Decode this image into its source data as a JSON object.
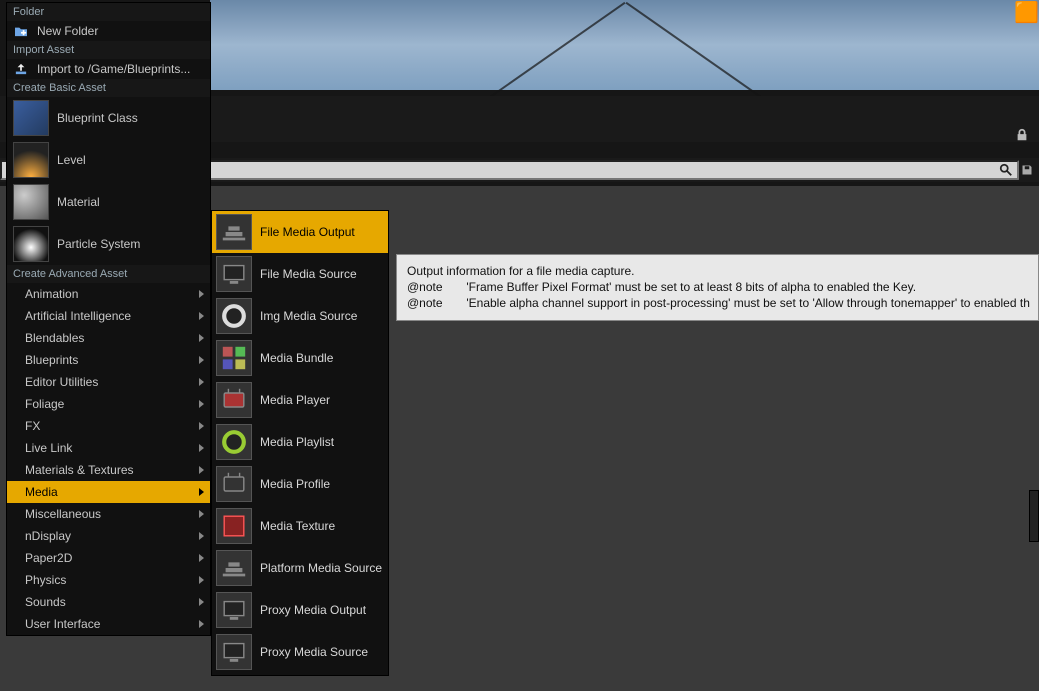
{
  "contextMenu": {
    "sections": {
      "folder": {
        "header": "Folder",
        "newFolder": "New Folder"
      },
      "importAsset": {
        "header": "Import Asset",
        "importTo": "Import to /Game/Blueprints..."
      },
      "createBasic": {
        "header": "Create Basic Asset",
        "items": {
          "blueprintClass": "Blueprint Class",
          "level": "Level",
          "material": "Material",
          "particleSystem": "Particle System"
        }
      },
      "createAdvanced": {
        "header": "Create Advanced Asset",
        "items": [
          "Animation",
          "Artificial Intelligence",
          "Blendables",
          "Blueprints",
          "Editor Utilities",
          "Foliage",
          "FX",
          "Live Link",
          "Materials & Textures",
          "Media",
          "Miscellaneous",
          "nDisplay",
          "Paper2D",
          "Physics",
          "Sounds",
          "User Interface"
        ],
        "selected": "Media"
      }
    }
  },
  "mediaSubmenu": {
    "items": [
      "File Media Output",
      "File Media Source",
      "Img Media Source",
      "Media Bundle",
      "Media Player",
      "Media Playlist",
      "Media Profile",
      "Media Texture",
      "Platform Media Source",
      "Proxy Media Output",
      "Proxy Media Source"
    ],
    "selected": "File Media Output"
  },
  "tooltip": {
    "line1": "Output information for a file media capture.",
    "noteTag": "@note",
    "line2": "'Frame Buffer Pixel Format' must be set to at least 8 bits of alpha to enabled the Key.",
    "line3": "'Enable alpha channel support in post-processing' must be set to 'Allow through tonemapper' to enabled th"
  },
  "search": {
    "placeholder": ""
  }
}
